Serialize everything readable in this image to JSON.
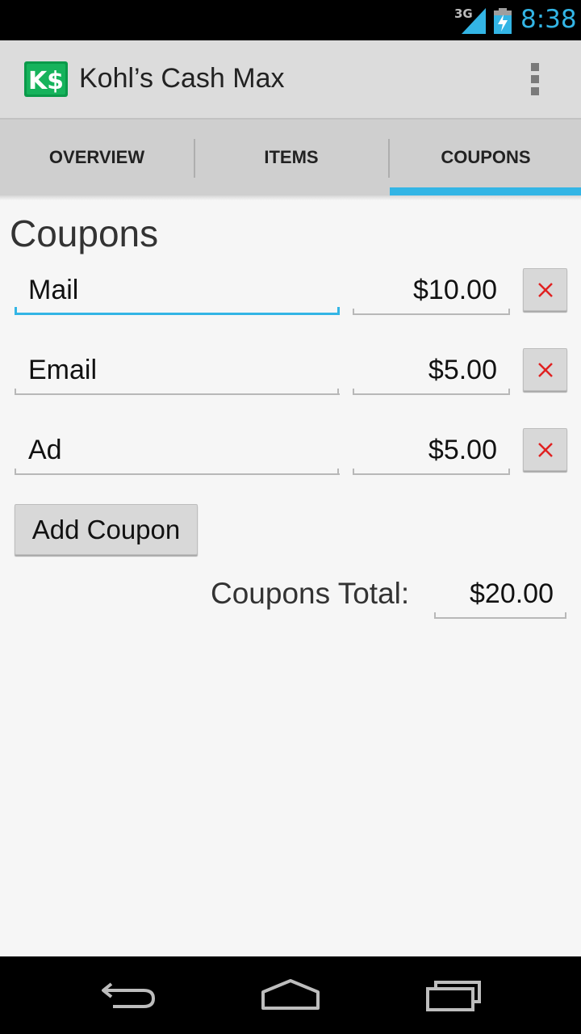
{
  "status_bar": {
    "network": "3G",
    "time": "8:38"
  },
  "app": {
    "title": "Kohl’s Cash Max",
    "logo_text": "K$",
    "brand_color": "#0a9a4a"
  },
  "tabs": [
    {
      "label": "OVERVIEW"
    },
    {
      "label": "ITEMS"
    },
    {
      "label": "COUPONS"
    }
  ],
  "active_tab_color": "#33b5e5",
  "main": {
    "title": "Coupons",
    "coupons": [
      {
        "name": "Mail",
        "amount": "$10.00"
      },
      {
        "name": "Email",
        "amount": "$5.00"
      },
      {
        "name": "Ad",
        "amount": "$5.00"
      }
    ],
    "add_button_label": "Add Coupon",
    "total_label": "Coupons Total:",
    "total_value": "$20.00"
  }
}
